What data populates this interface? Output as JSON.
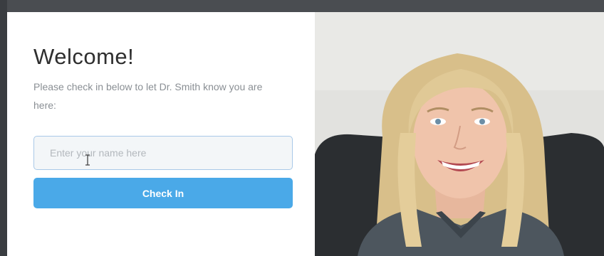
{
  "modal": {
    "title": "Welcome!",
    "subtitle": "Please check in below to let Dr. Smith know you are here:",
    "name_input": {
      "value": "",
      "placeholder": "Enter your name here"
    },
    "checkin_button_label": "Check In"
  },
  "video": {
    "subject": "person-video-feed"
  },
  "colors": {
    "button": "#4aa9e8",
    "input_border": "#a9c9e8",
    "input_bg": "#f3f6f8",
    "backdrop": "#3f4246"
  }
}
